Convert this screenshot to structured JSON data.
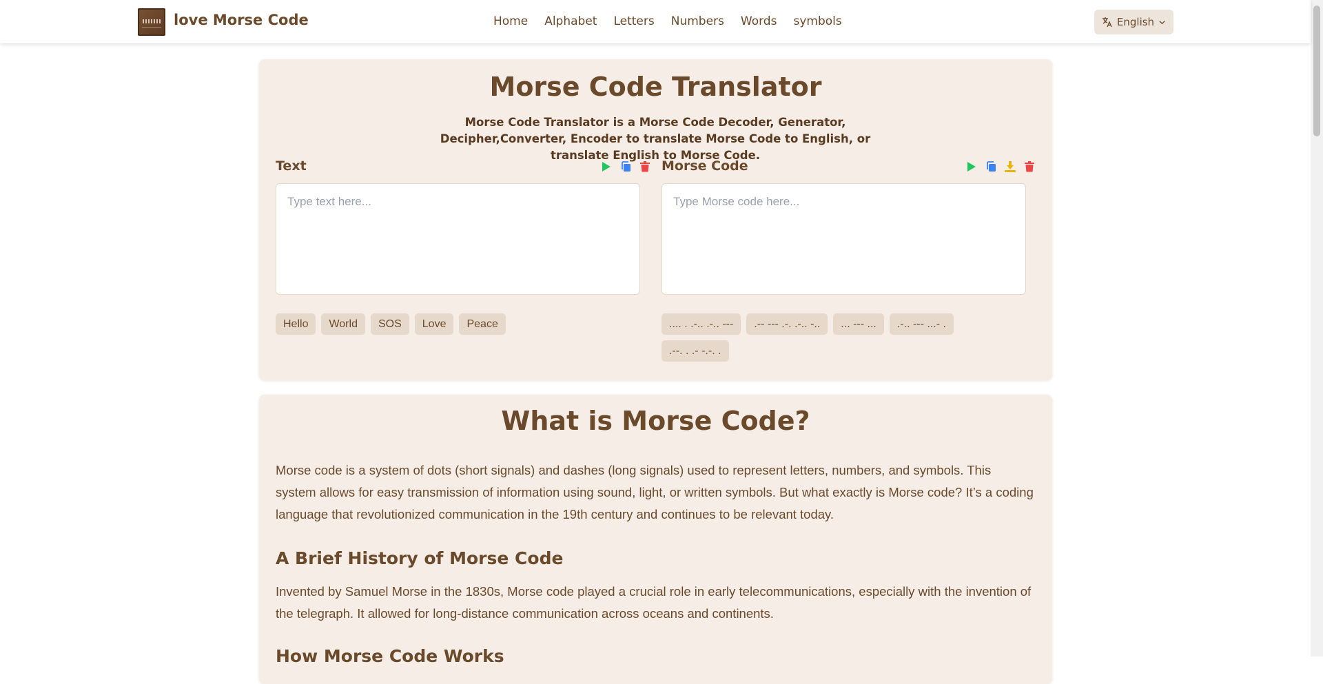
{
  "header": {
    "brand": "love Morse Code",
    "nav": [
      "Home",
      "Alphabet",
      "Letters",
      "Numbers",
      "Words",
      "symbols"
    ],
    "language": "English"
  },
  "translator": {
    "title": "Morse Code Translator",
    "subtitle": "Morse Code Translator is a Morse Code Decoder, Generator, Decipher,Converter, Encoder to translate Morse Code to English, or translate English to Morse Code.",
    "text_panel": {
      "label": "Text",
      "placeholder": "Type text here...",
      "examples": [
        "Hello",
        "World",
        "SOS",
        "Love",
        "Peace"
      ]
    },
    "morse_panel": {
      "label": "Morse Code",
      "placeholder": "Type Morse code here...",
      "examples": [
        ".... . .-.. .-.. ---",
        ".-- --- .-. .-.. -..",
        "... --- ...",
        ".-.. --- ...- .",
        ".--. . .- -.-. ."
      ]
    },
    "icon_colors": {
      "play": "#22c55e",
      "copy": "#3b82f6",
      "download": "#eab308",
      "delete": "#ef4444"
    }
  },
  "info": {
    "title": "What is Morse Code?",
    "intro": "Morse code is a system of dots (short signals) and dashes (long signals) used to represent letters, numbers, and symbols. This system allows for easy transmission of information using sound, light, or written symbols. But what exactly is Morse code? It’s a coding language that revolutionized communication in the 19th century and continues to be relevant today.",
    "history_title": "A Brief History of Morse Code",
    "history_text": "Invented by Samuel Morse in the 1830s, Morse code played a crucial role in early telecommunications, especially with the invention of the telegraph. It allowed for long-distance communication across oceans and continents.",
    "how_title": "How Morse Code Works"
  }
}
